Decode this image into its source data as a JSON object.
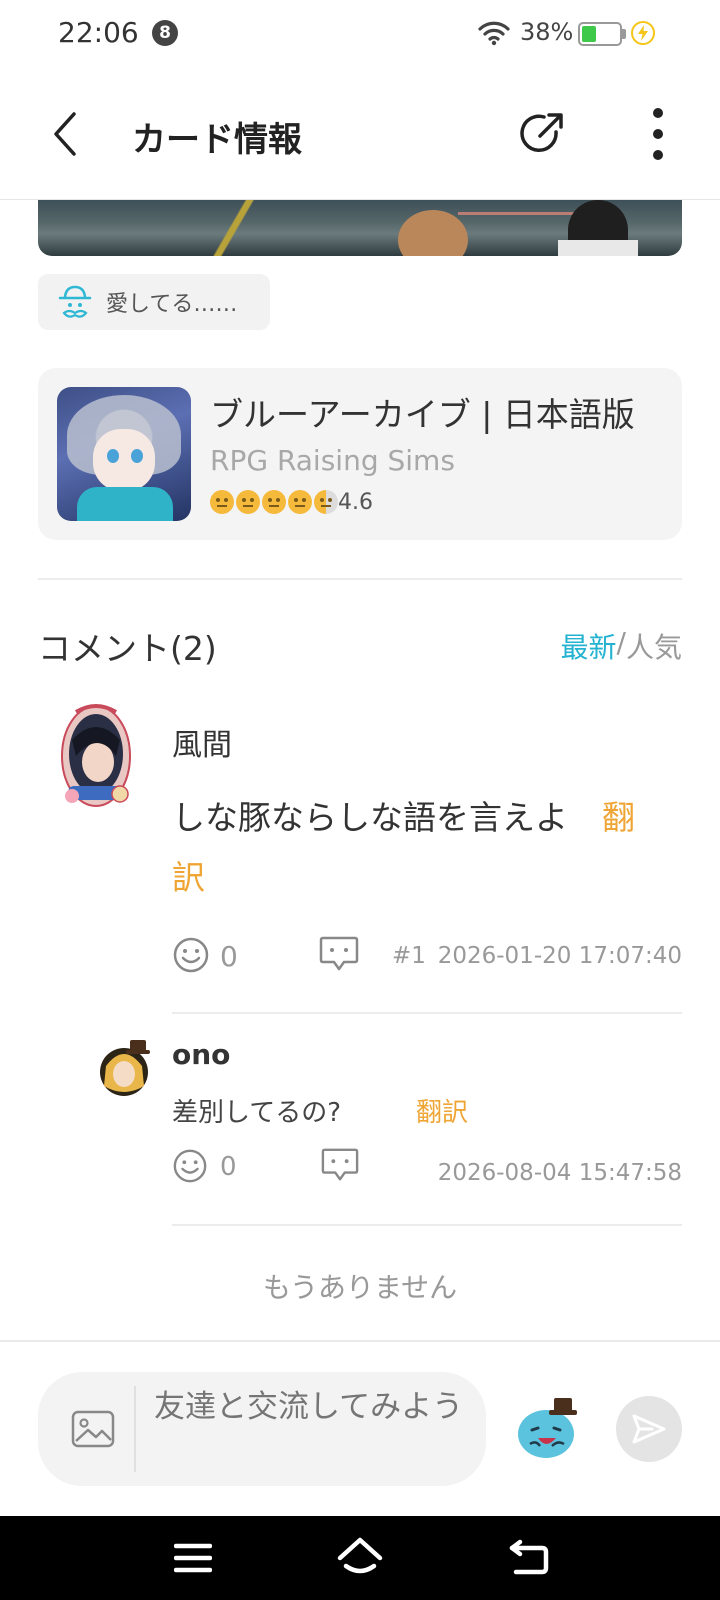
{
  "status_bar": {
    "time": "22:06",
    "notification_count": "8",
    "battery_percent": "38%",
    "battery_level": 0.38,
    "icons": [
      "wifi-icon",
      "battery-icon",
      "charging-icon"
    ]
  },
  "header": {
    "title": "カード情報",
    "back_icon": "chevron-left-icon",
    "share_icon": "share-icon",
    "more_icon": "more-vertical-icon"
  },
  "tag": {
    "label": "愛してる……",
    "icon": "hat-mascot-icon"
  },
  "game": {
    "title": "ブルーアーカイブ | 日本語版",
    "genre": "RPG Raising Sims",
    "rating": "4.6",
    "rating_value": 4.6,
    "rating_max": 5
  },
  "comments": {
    "title": "コメント(2)",
    "sort_latest": "最新",
    "sort_separator": "/",
    "sort_popular": "人気",
    "sort_selected": "最新",
    "items": [
      {
        "author": "風間",
        "text": "しな豚ならしな語を言えよ",
        "translate": "翻訳",
        "likes": "0",
        "index": "#1",
        "time": "2026-01-20 17:07:40"
      }
    ],
    "reply": {
      "author": "ono",
      "text": "差別してるの?",
      "translate": "翻訳",
      "likes": "0",
      "time": "2026-08-04 15:47:58"
    },
    "end_text": "もうありません"
  },
  "composer": {
    "placeholder": "友達と交流してみよう",
    "image_icon": "image-icon",
    "emoji_icon": "emoji-mascot-icon",
    "send_icon": "send-icon"
  },
  "colors": {
    "accent": "#23b3d1",
    "translate": "#efa534",
    "muted": "#999999",
    "rating": "#f5b93c"
  }
}
